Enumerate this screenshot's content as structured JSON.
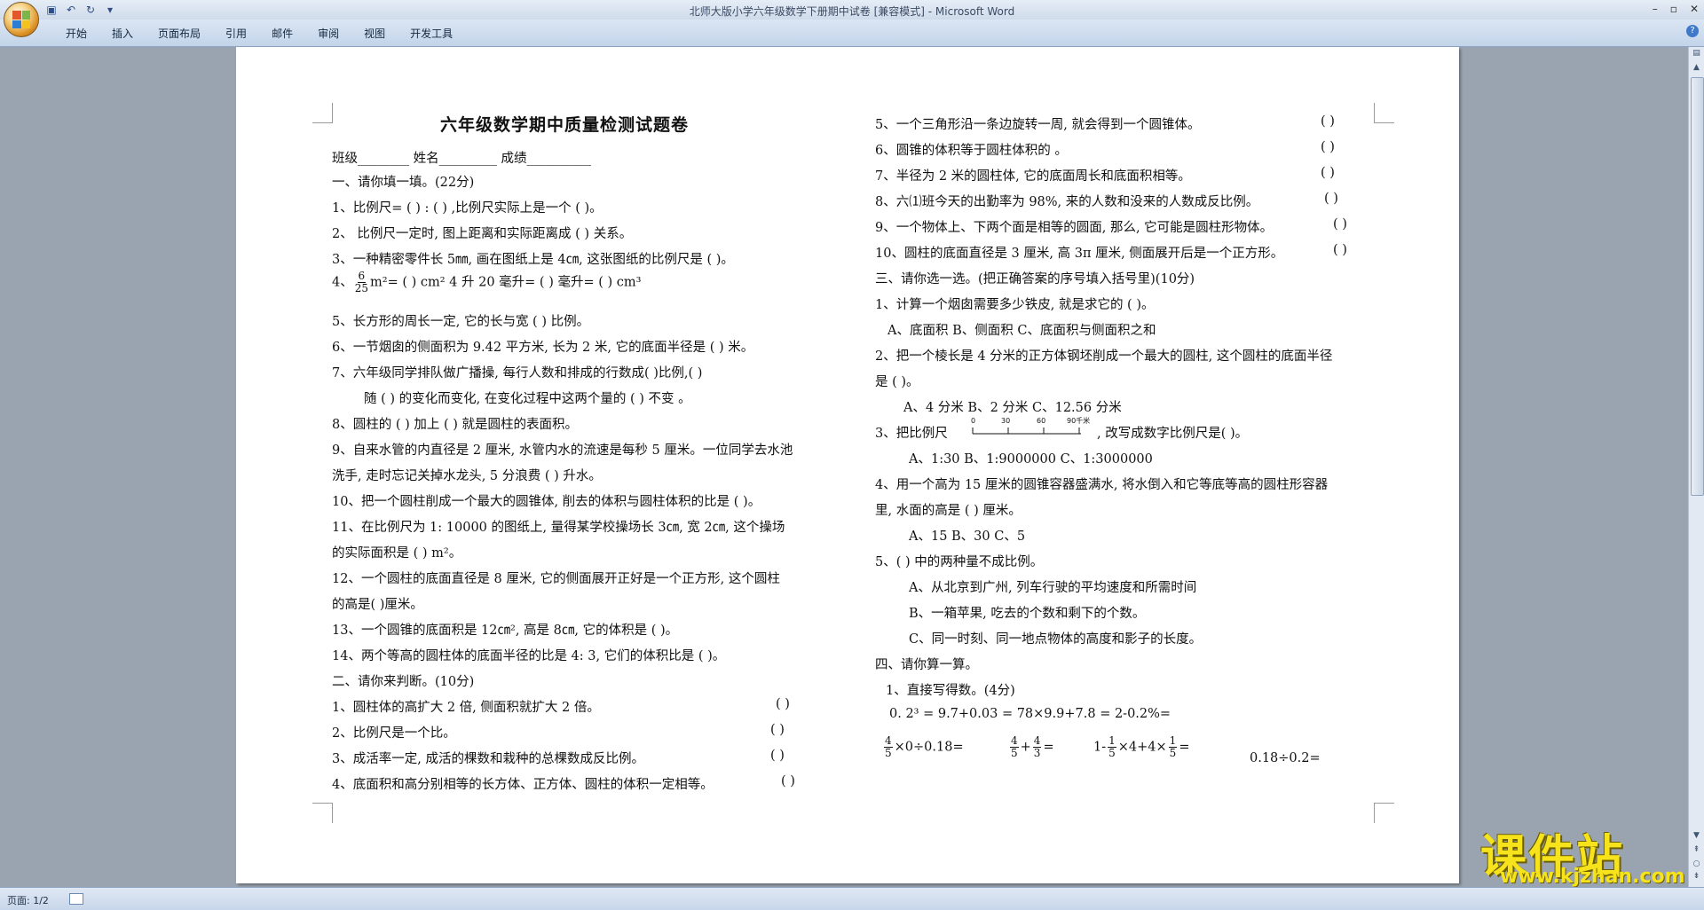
{
  "window": {
    "title": "北师大版小学六年级数学下册期中试卷 [兼容模式] - Microsoft Word",
    "controls": [
      "–",
      "▫",
      "✕"
    ]
  },
  "ribbon": {
    "tabs": [
      "开始",
      "插入",
      "页面布局",
      "引用",
      "邮件",
      "审阅",
      "视图",
      "开发工具"
    ]
  },
  "document": {
    "title": "六年级数学期中质量检测试题卷",
    "header": "班级________    姓名_________        成绩__________",
    "left": [
      "一、请你填一填。(22分)",
      "1、比例尺= (            ) : (              ) ,比例尺实际上是一个 (        )。",
      "2、 比例尺一定时, 图上距离和实际距离成 (        ) 关系。",
      "3、一种精密零件长 5㎜, 画在图纸上是 4㎝, 这张图纸的比例尺是 (        )。",
      "5、长方形的周长一定, 它的长与宽 (          ) 比例。",
      "6、一节烟囱的侧面积为 9.42 平方米, 长为 2 米, 它的底面半径是 (        ) 米。",
      "7、六年级同学排队做广播操, 每行人数和排成的行数成(         )比例,(           )",
      "随 (           ) 的变化而变化, 在变化过程中这两个量的 (      ) 不变 。",
      "8、圆柱的 (           ) 加上 (           ) 就是圆柱的表面积。",
      "9、自来水管的内直径是 2 厘米, 水管内水的流速是每秒 5 厘米。一位同学去水池",
      "洗手, 走时忘记关掉水龙头, 5 分浪费 (           ) 升水。",
      "10、把一个圆柱削成一个最大的圆锥体, 削去的体积与圆柱体积的比是 (        )。",
      "11、在比例尺为 1: 10000 的图纸上, 量得某学校操场长 3㎝, 宽 2㎝, 这个操场",
      "的实际面积是 (        ) m²。",
      "12、一个圆柱的底面直径是 8 厘米, 它的侧面展开正好是一个正方形, 这个圆柱",
      "的高是(         )厘米。",
      "13、一个圆锥的底面积是 12㎝², 高是 8㎝, 它的体积是 (           )。",
      "14、两个等高的圆柱体的底面半径的比是 4: 3, 它们的体积比是 (            )。",
      "二、请你来判断。(10分)",
      "1、圆柱体的高扩大 2 倍, 侧面积就扩大 2 倍。",
      "2、比例尺是一个比。",
      "3、成活率一定, 成活的棵数和栽种的总棵数成反比例。",
      "4、底面积和高分别相等的长方体、正方体、圆柱的体积一定相等。"
    ],
    "q4": {
      "prefix": "4、",
      "num": "6",
      "den": "25",
      "rest": "m²= (    ) cm²    4 升 20 毫升= (       ) 毫升= (       ) cm³"
    },
    "right": [
      "5、一个三角形沿一条边旋转一周, 就会得到一个圆锥体。",
      "6、圆锥的体积等于圆柱体积的 。",
      "7、半径为 2 米的圆柱体, 它的底面周长和底面积相等。",
      "8、六⑴班今天的出勤率为 98%, 来的人数和没来的人数成反比例。",
      "9、一个物体上、下两个面是相等的圆面, 那么, 它可能是圆柱形物体。",
      "10、圆柱的底面直径是 3 厘米, 高 3π 厘米, 侧面展开后是一个正方形。",
      "三、请你选一选。(把正确答案的序号填入括号里)(10分)",
      "1、计算一个烟囱需要多少铁皮, 就是求它的 (        )。",
      "A、底面积  B、侧面积   C、底面积与侧面积之和",
      "2、把一个棱长是 4 分米的正方体钢坯削成一个最大的圆柱, 这个圆柱的底面半径",
      "是 (    )。",
      "A、4 分米    B、2 分米    C、12.56 分米",
      "3、把比例尺",
      "A、1:30          B、1:9000000          C、1:3000000",
      "4、用一个高为 15 厘米的圆锥容器盛满水, 将水倒入和它等底等高的圆柱形容器",
      "里, 水面的高是 (      ) 厘米。",
      "A、15       B、30       C、5",
      "5、(      ) 中的两种量不成比例。",
      "A、从北京到广州, 列车行驶的平均速度和所需时间",
      "B、一箱苹果, 吃去的个数和剩下的个数。",
      "C、同一时刻、同一地点物体的高度和影子的长度。",
      "四、请你算一算。",
      "1、直接写得数。(4分)",
      "0. 2³ =            9.7+0.03 =          78×9.9+7.8 =          2-0.2%="
    ],
    "judge_mark": "(      )",
    "scale_labels": [
      "0",
      "30",
      "60",
      "90千米"
    ],
    "scale_suffix": ",  改写成数字比例尺是(        )。",
    "calc": {
      "item1": {
        "num": "4",
        "den": "5",
        "rest": "×0÷0.18="
      },
      "item2": {
        "num1": "4",
        "den1": "5",
        "plus": "+",
        "num2": "4",
        "den2": "3",
        "eq": "="
      },
      "item3": {
        "lead": "1-",
        "num": "1",
        "den": "5",
        "mid": "×4+4×",
        "num2": "1",
        "den2": "5",
        "eq": "="
      },
      "item4": "0.18÷0.2="
    }
  },
  "status": {
    "page": "页面: 1/2"
  },
  "watermark": {
    "brand": "课件站",
    "url": "www.kjzhan.com"
  }
}
